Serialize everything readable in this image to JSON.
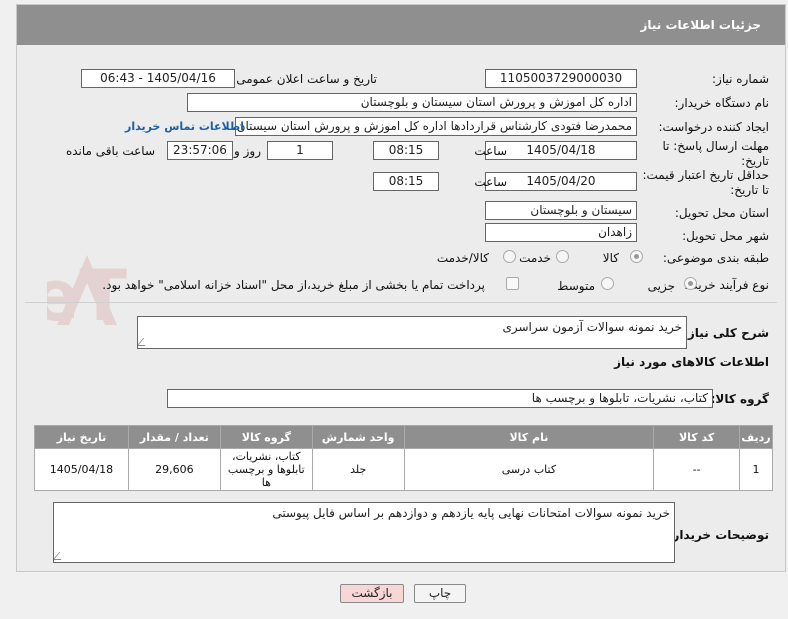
{
  "header": {
    "title": "جزئیات اطلاعات نیاز"
  },
  "fields": {
    "need_number_label": "شماره نیاز:",
    "need_number": "1105003729000030",
    "announce_label": "تاریخ و ساعت اعلان عمومی:",
    "announce_value": "1405/04/16 - 06:43",
    "buyer_org_label": "نام دستگاه خریدار:",
    "buyer_org": "اداره کل اموزش و پرورش استان سیستان و بلوچستان",
    "creator_label": "ایجاد کننده درخواست:",
    "creator": "محمدرضا فتودی کارشناس قراردادها اداره کل اموزش و پرورش استان سیستان و",
    "contact_link": "اطلاعات تماس خریدار",
    "reply_deadline_label": "مهلت ارسال پاسخ: تا تاریخ:",
    "reply_date": "1405/04/18",
    "time_label": "ساعت",
    "reply_time": "08:15",
    "days_value": "1",
    "days_label": "روز و",
    "remaining_time": "23:57:06",
    "remaining_label": "ساعت باقی مانده",
    "price_deadline_label": "حداقل تاریخ اعتبار قیمت: تا تاریخ:",
    "price_date": "1405/04/20",
    "price_time": "08:15",
    "province_label": "استان محل تحویل:",
    "province": "سیستان و بلوچستان",
    "city_label": "شهر محل تحویل:",
    "city": "زاهدان",
    "category_label": "طبقه بندی موضوعی:",
    "cat_goods": "کالا",
    "cat_service": "خدمت",
    "cat_both": "کالا/خدمت",
    "process_label": "نوع فرآیند خرید :",
    "proc_partial": "جزیی",
    "proc_medium": "متوسط",
    "payment_note": "پرداخت تمام یا بخشی از مبلغ خرید،از محل \"اسناد خزانه اسلامی\" خواهد بود."
  },
  "summary": {
    "label": "شرح کلی نیاز:",
    "value": "خرید نمونه سوالات آزمون سراسری"
  },
  "goods_info": {
    "title": "اطلاعات کالاهای مورد نیاز"
  },
  "goods_group": {
    "label": "گروه کالا:",
    "value": "کتاب، نشریات، تابلوها و برچسب ها"
  },
  "table": {
    "headers": [
      "ردیف",
      "کد کالا",
      "نام کالا",
      "واحد شمارش",
      "گروه کالا",
      "تعداد / مقدار",
      "تاریخ نیاز"
    ],
    "rows": [
      [
        "1",
        "--",
        "کتاب درسی",
        "جلد",
        "کتاب، نشریات، تابلوها و برچسب ها",
        "29,606",
        "1405/04/18"
      ]
    ]
  },
  "buyer_notes": {
    "label": "توضیحات خریدار:",
    "value": "خرید نمونه سوالات امتحانات نهایی پایه یازدهم و دوازدهم بر اساس فایل پیوستی"
  },
  "buttons": {
    "print": "چاپ",
    "back": "بازگشت"
  },
  "watermark": {
    "text": "AriaTender.neT"
  },
  "colors": {
    "header_bg": "#8f8f8f",
    "link": "#1b5fa6",
    "back_btn": "#f7d6d6"
  }
}
